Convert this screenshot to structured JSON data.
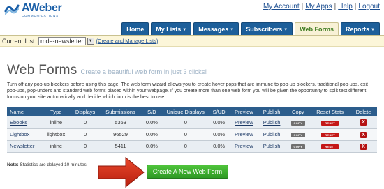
{
  "brand": {
    "name": "AWeber",
    "sub": "COMMUNICATIONS",
    "color": "#1a5fa8"
  },
  "toplinks": [
    "My Account",
    "My Apps",
    "Help",
    "Logout"
  ],
  "nav": [
    {
      "label": "Home",
      "dropdown": false,
      "active": false
    },
    {
      "label": "My Lists",
      "dropdown": true,
      "active": false
    },
    {
      "label": "Messages",
      "dropdown": true,
      "active": false
    },
    {
      "label": "Subscribers",
      "dropdown": true,
      "active": false
    },
    {
      "label": "Web Forms",
      "dropdown": false,
      "active": true
    },
    {
      "label": "Reports",
      "dropdown": true,
      "active": false
    }
  ],
  "listbar": {
    "label": "Current List:",
    "selected": "mde-newsletter",
    "manage_link": "(Create and Manage Lists)"
  },
  "page": {
    "title": "Web Forms",
    "subtitle": "Create a beautiful web form in just 3 clicks!",
    "description": "Turn off any pop-up blockers before using this page. The web form wizard allows you to create hover pops that are immune to pop-up blockers, traditional pop-ups, exit pop-ups, pop-unders and standard web forms placed within your webpage. If you create more than one web form you will be given the opportunity to split test different forms on your site automatically and decide which form is the best to use."
  },
  "table": {
    "headers": [
      "Name",
      "Type",
      "Displays",
      "Submissions",
      "S/D",
      "Unique Displays",
      "S/UD",
      "Preview",
      "Publish",
      "Copy",
      "Reset Stats",
      "Delete"
    ],
    "rows": [
      {
        "name": "Ebooks",
        "type": "inline",
        "displays": "0",
        "submissions": "5363",
        "sd": "0.0%",
        "unique": "0",
        "sud": "0.0%",
        "preview": "Preview",
        "publish": "Publish",
        "copy": "COPY",
        "reset": "RESET",
        "delete": "X"
      },
      {
        "name": "Lightbox",
        "type": "lightbox",
        "displays": "0",
        "submissions": "96529",
        "sd": "0.0%",
        "unique": "0",
        "sud": "0.0%",
        "preview": "Preview",
        "publish": "Publish",
        "copy": "COPY",
        "reset": "RESET",
        "delete": "X"
      },
      {
        "name": "Newsletter",
        "type": "inline",
        "displays": "0",
        "submissions": "5411",
        "sd": "0.0%",
        "unique": "0",
        "sud": "0.0%",
        "preview": "Preview",
        "publish": "Publish",
        "copy": "COPY",
        "reset": "RESET",
        "delete": "X"
      }
    ]
  },
  "note": {
    "bold": "Note:",
    "text": "Statistics are delayed 10 minutes."
  },
  "create_button": "Create A New Web Form",
  "colors": {
    "nav_tab": "#1d5f9a",
    "active_tab_text": "#3c7a1f",
    "table_header": "#2c5d8c",
    "create_button": "#3aac2c",
    "arrow": "#d8321c"
  }
}
